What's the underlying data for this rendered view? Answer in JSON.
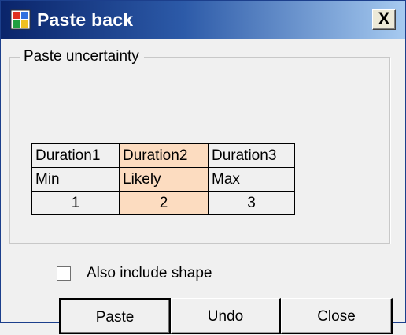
{
  "window": {
    "title": "Paste back",
    "close_glyph": "X",
    "icon": "app-window-icon"
  },
  "group": {
    "legend": "Paste uncertainty"
  },
  "grid": {
    "rows": [
      [
        "Duration1",
        "Duration2",
        "Duration3"
      ],
      [
        "Min",
        "Likely",
        "Max"
      ],
      [
        "1",
        "2",
        "3"
      ]
    ],
    "highlight_color": "#fcdcc0"
  },
  "options": {
    "include_shape_label": "Also include shape",
    "include_shape_checked": false
  },
  "buttons": {
    "paste": "Paste",
    "undo": "Undo",
    "close": "Close"
  },
  "colors": {
    "titlebar_start": "#0a246a",
    "titlebar_end": "#a6caf0",
    "dialog_bg": "#f0f0f0"
  }
}
